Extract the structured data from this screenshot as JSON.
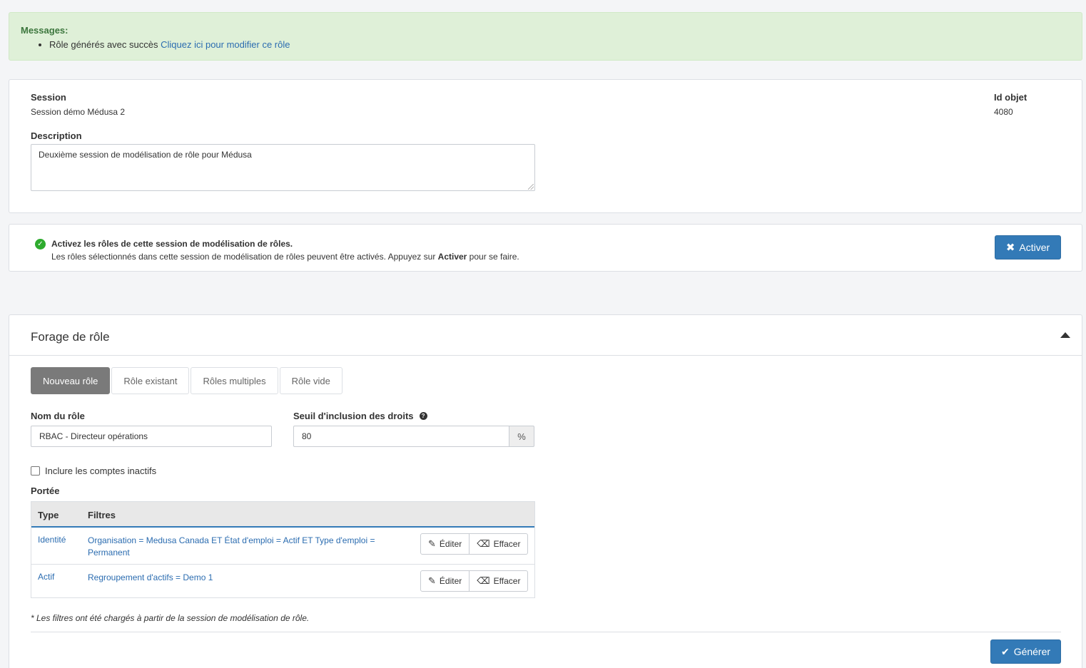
{
  "messages": {
    "title": "Messages:",
    "items": [
      {
        "text": "Rôle générés avec succès",
        "link": "Cliquez ici pour modifier ce rôle"
      }
    ]
  },
  "session": {
    "label": "Session",
    "value": "Session démo Médusa 2",
    "id_label": "Id objet",
    "id_value": "4080",
    "description_label": "Description",
    "description_value": "Deuxième session de modélisation de rôle pour Médusa"
  },
  "activate": {
    "title": "Activez les rôles de cette session de modélisation de rôles.",
    "text_before": "Les rôles sélectionnés dans cette session de modélisation de rôles peuvent être activés. Appuyez sur ",
    "text_bold": "Activer",
    "text_after": " pour se faire.",
    "button_label": "Activer",
    "check_icon": "check-circle-icon",
    "accent": "#2eab2e"
  },
  "forage": {
    "title": "Forage de rôle",
    "tabs": [
      {
        "label": "Nouveau rôle",
        "active": true
      },
      {
        "label": "Rôle existant",
        "active": false
      },
      {
        "label": "Rôles multiples",
        "active": false
      },
      {
        "label": "Rôle vide",
        "active": false
      }
    ],
    "nom_label": "Nom du rôle",
    "nom_value": "RBAC - Directeur opérations",
    "seuil_label": "Seuil d'inclusion des droits",
    "seuil_value": "80",
    "seuil_unit": "%",
    "inactive_label": "Inclure les comptes inactifs",
    "inactive_checked": false,
    "portee_label": "Portée",
    "table": {
      "headers": [
        "Type",
        "Filtres"
      ],
      "rows": [
        {
          "type": "Identité",
          "filter": "Organisation = Medusa Canada ET État d'emploi = Actif ET Type d'emploi = Permanent"
        },
        {
          "type": "Actif",
          "filter": "Regroupement d'actifs = Demo 1"
        }
      ],
      "edit_label": "Éditer",
      "clear_label": "Effacer"
    },
    "note": "* Les filtres ont été chargés à partir de la session de modélisation de rôle.",
    "generate_label": "Générer"
  },
  "colors": {
    "primary": "#337ab7",
    "success_bg": "#dff0d8",
    "link": "#2b6cb0"
  }
}
